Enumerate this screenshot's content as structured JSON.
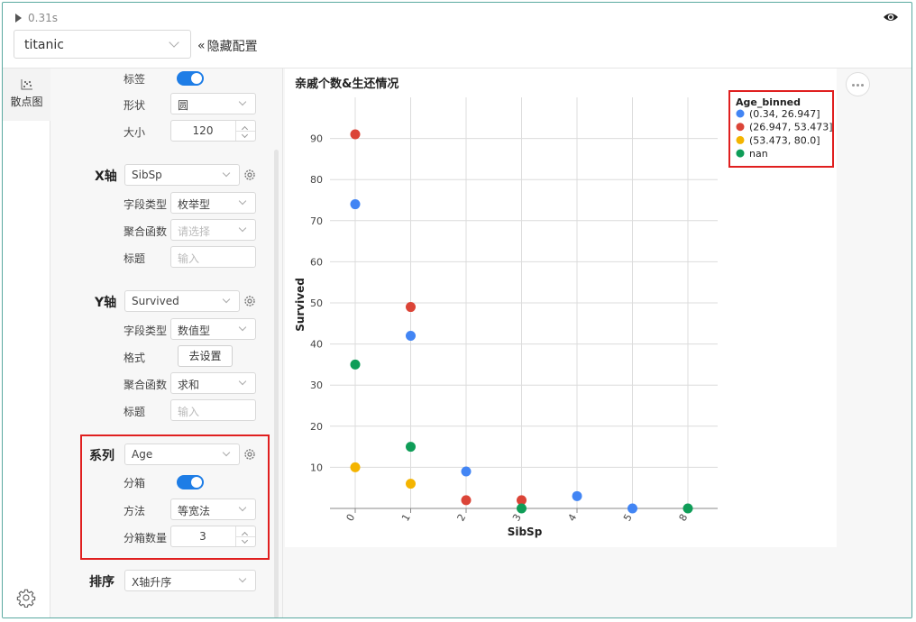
{
  "run": {
    "time": "0.31s"
  },
  "dataset": {
    "value": "titanic"
  },
  "hide_config": {
    "label": "隐藏配置",
    "chevrons": "«"
  },
  "side_tab": {
    "label": "散点图"
  },
  "config": {
    "label_row": {
      "label": "标签",
      "on": true
    },
    "shape": {
      "label": "形状",
      "value": "圆"
    },
    "size": {
      "label": "大小",
      "value": "120"
    },
    "x_axis": {
      "section": "X轴",
      "field": "SibSp",
      "field_type_label": "字段类型",
      "field_type": "枚举型",
      "agg_label": "聚合函数",
      "agg_placeholder": "请选择",
      "title_label": "标题",
      "title_placeholder": "输入"
    },
    "y_axis": {
      "section": "Y轴",
      "field": "Survived",
      "field_type_label": "字段类型",
      "field_type": "数值型",
      "format_label": "格式",
      "format_button": "去设置",
      "agg_label": "聚合函数",
      "agg_value": "求和",
      "title_label": "标题",
      "title_placeholder": "输入"
    },
    "series": {
      "section": "系列",
      "field": "Age",
      "bin_label": "分箱",
      "bin_on": true,
      "method_label": "方法",
      "method": "等宽法",
      "count_label": "分箱数量",
      "count": "3"
    },
    "sort": {
      "section": "排序",
      "value": "X轴升序"
    }
  },
  "colors": {
    "accent": "#1e7de6",
    "highlight": "#e01f1f"
  },
  "chart_data": {
    "type": "scatter",
    "title": "亲戚个数&生还情况",
    "xlabel": "SibSp",
    "ylabel": "Survived",
    "categories": [
      "0",
      "1",
      "2",
      "3",
      "4",
      "5",
      "8"
    ],
    "ylim": [
      0,
      100
    ],
    "yticks": [
      "10",
      "20",
      "30",
      "40",
      "50",
      "60",
      "70",
      "80",
      "90"
    ],
    "grid": true,
    "legend_title": "Age_binned",
    "legend_position": "top-right",
    "series": [
      {
        "name": "(0.34, 26.947]",
        "color": "#4285f4",
        "points": [
          [
            "0",
            74
          ],
          [
            "1",
            42
          ],
          [
            "2",
            9
          ],
          [
            "4",
            3
          ],
          [
            "5",
            0
          ]
        ]
      },
      {
        "name": "(26.947, 53.473]",
        "color": "#db4437",
        "points": [
          [
            "0",
            91
          ],
          [
            "1",
            49
          ],
          [
            "2",
            2
          ],
          [
            "3",
            2
          ]
        ]
      },
      {
        "name": "(53.473, 80.0]",
        "color": "#f4b400",
        "points": [
          [
            "0",
            10
          ],
          [
            "1",
            6
          ]
        ]
      },
      {
        "name": "nan",
        "color": "#0f9d58",
        "points": [
          [
            "0",
            35
          ],
          [
            "1",
            15
          ],
          [
            "3",
            0
          ],
          [
            "8",
            0
          ]
        ]
      }
    ]
  }
}
